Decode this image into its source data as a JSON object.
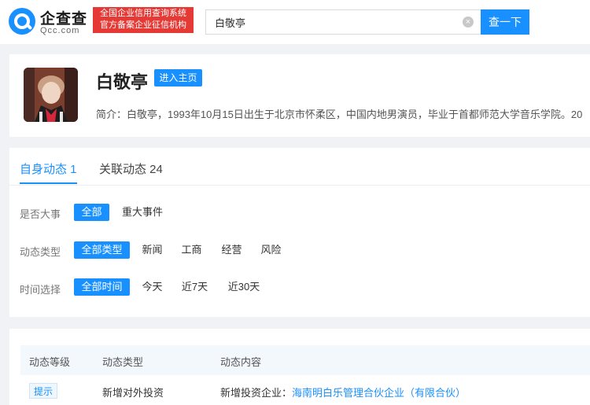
{
  "header": {
    "logo_cn": "企查查",
    "logo_en": "Qcc.com",
    "badge_line1": "全国企业信用查询系统",
    "badge_line2": "官方备案企业征信机构",
    "search_value": "白敬亭",
    "search_button": "查一下",
    "clear_icon": "×"
  },
  "profile": {
    "name": "白敬亭",
    "enter_button": "进入主页",
    "bio": "简介：白敬亭，1993年10月15日出生于北京市怀柔区，中国内地男演员，毕业于首都师范大学音乐学院。20"
  },
  "tabs": [
    {
      "label": "自身动态 1"
    },
    {
      "label": "关联动态 24"
    }
  ],
  "filters": {
    "major": {
      "label": "是否大事",
      "options": [
        "全部",
        "重大事件"
      ]
    },
    "type": {
      "label": "动态类型",
      "options": [
        "全部类型",
        "新闻",
        "工商",
        "经营",
        "风险"
      ]
    },
    "time": {
      "label": "时间选择",
      "options": [
        "全部时间",
        "今天",
        "近7天",
        "近30天"
      ]
    }
  },
  "table": {
    "columns": [
      "动态等级",
      "动态类型",
      "动态内容"
    ],
    "rows": [
      {
        "level": "提示",
        "type": "新增对外投资",
        "content_prefix": "新增投资企业：",
        "content_link": "海南明白乐管理合伙企业（有限合伙）"
      }
    ]
  },
  "colors": {
    "accent": "#1890ff",
    "brand_red": "#e53935"
  }
}
